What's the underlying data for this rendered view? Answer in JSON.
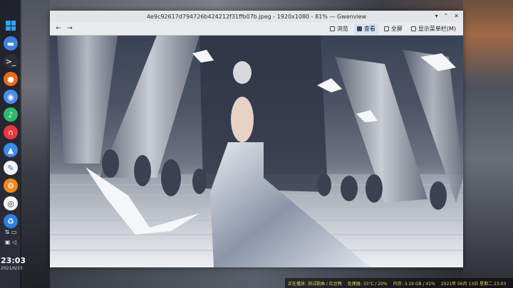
{
  "window": {
    "title": "4e9c92617d794726b424212f31ffb07b.jpeg - 1920x1080 - 81% — Gwenview",
    "controls": [
      "▾",
      "⌃",
      "✕"
    ]
  },
  "toolbar": {
    "back": "←",
    "forward": "→",
    "browse_label": "浏览",
    "view_label": "查看",
    "fullscreen_label": "全屏",
    "show_menubar_label": "显示菜单栏(M)"
  },
  "dock": {
    "clock_time": "23:03",
    "clock_date": "2021/6/15"
  },
  "statusbar": {
    "items": [
      "正在播放: 测试歌曲 / 红豆鸭",
      "处理器: 33°C / 20%",
      "内存: 3.19 GB / 41%",
      "2021年 06月 13日 星期二 23:03"
    ]
  },
  "colors": {
    "accent": "#d3e3f7",
    "status_text": "#f2d15a"
  }
}
